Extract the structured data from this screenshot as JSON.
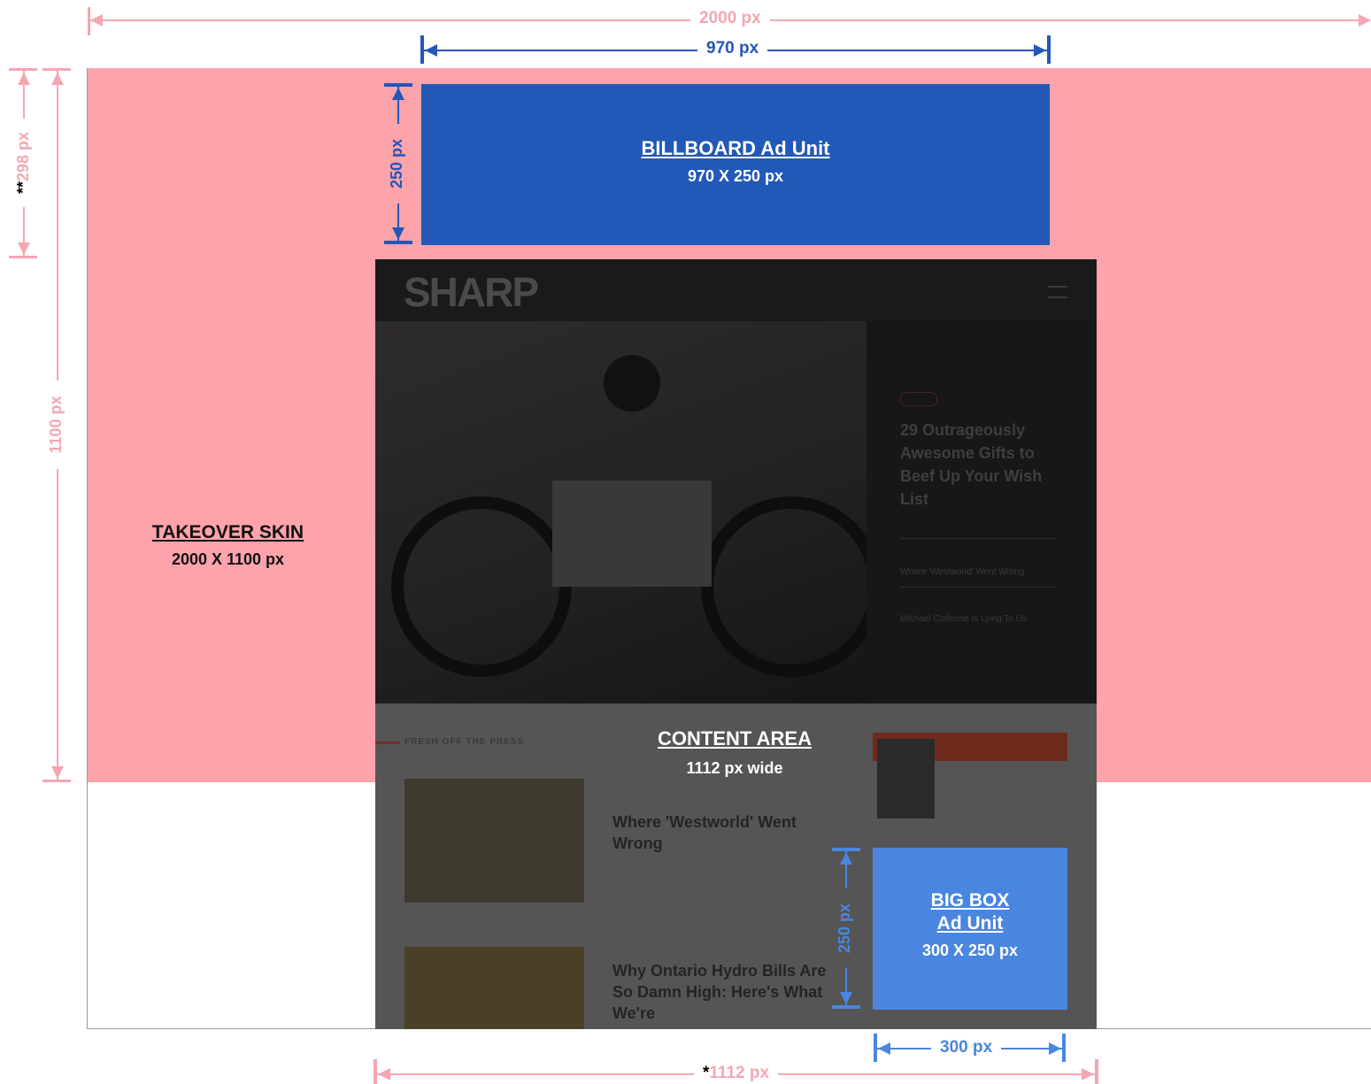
{
  "dimensions": {
    "total_width": "2000 px",
    "billboard_width": "970 px",
    "billboard_height": "250 px",
    "top_offset_marker": "**",
    "top_offset": "298 px",
    "skin_height": "1100 px",
    "bigbox_height": "250 px",
    "bigbox_width": "300 px",
    "content_width_marker": "*",
    "content_width": "1112 px"
  },
  "billboard": {
    "title": "BILLBOARD Ad Unit",
    "size": "970 X 250 px"
  },
  "skin": {
    "title": "TAKEOVER SKIN",
    "size": "2000 X 1100 px"
  },
  "content": {
    "title": "CONTENT AREA",
    "size": "1112 px wide"
  },
  "bigbox": {
    "title_line1": "BIG BOX",
    "title_line2": "Ad Unit",
    "size": "300 X 250 px"
  },
  "site": {
    "logo": "SHARP",
    "hero_headline": "29 Outrageously Awesome Gifts to Beef Up Your Wish List",
    "side_link_1": "Where 'Westworld' Went Wrong",
    "side_link_2": "Michael Corleone Is Lying To Us",
    "section_label": "FRESH OFF THE PRESS",
    "article_1_title": "Where 'Westworld' Went Wrong",
    "article_2_title": "Why Ontario Hydro Bills Are So Damn High: Here's What We're"
  },
  "colors": {
    "pink": "#f4a7b2",
    "skin": "#fca3ab",
    "billboard_blue": "#2258b8",
    "bigbox_blue": "#4a86e0",
    "site_dark": "#1c1c1c"
  }
}
